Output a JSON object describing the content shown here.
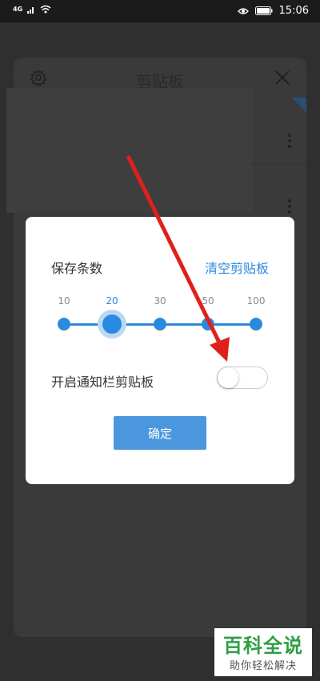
{
  "status_bar": {
    "signal_text": "4G",
    "time": "15:06"
  },
  "clipboard_panel": {
    "title": "剪贴板"
  },
  "dialog": {
    "save_count_label": "保存条数",
    "clear_label": "清空剪贴板",
    "slider": {
      "ticks": [
        "10",
        "20",
        "30",
        "50",
        "100"
      ],
      "selected": "20"
    },
    "notification_label": "开启通知栏剪贴板",
    "notification_enabled": false,
    "confirm_label": "确定"
  },
  "watermark": {
    "brand": "百科全说",
    "slogan": "助你轻松解决"
  },
  "colors": {
    "accent": "#2a8ae0",
    "button": "#4a97dd",
    "arrow": "#e0201a",
    "watermark_green": "#2f9e44"
  }
}
